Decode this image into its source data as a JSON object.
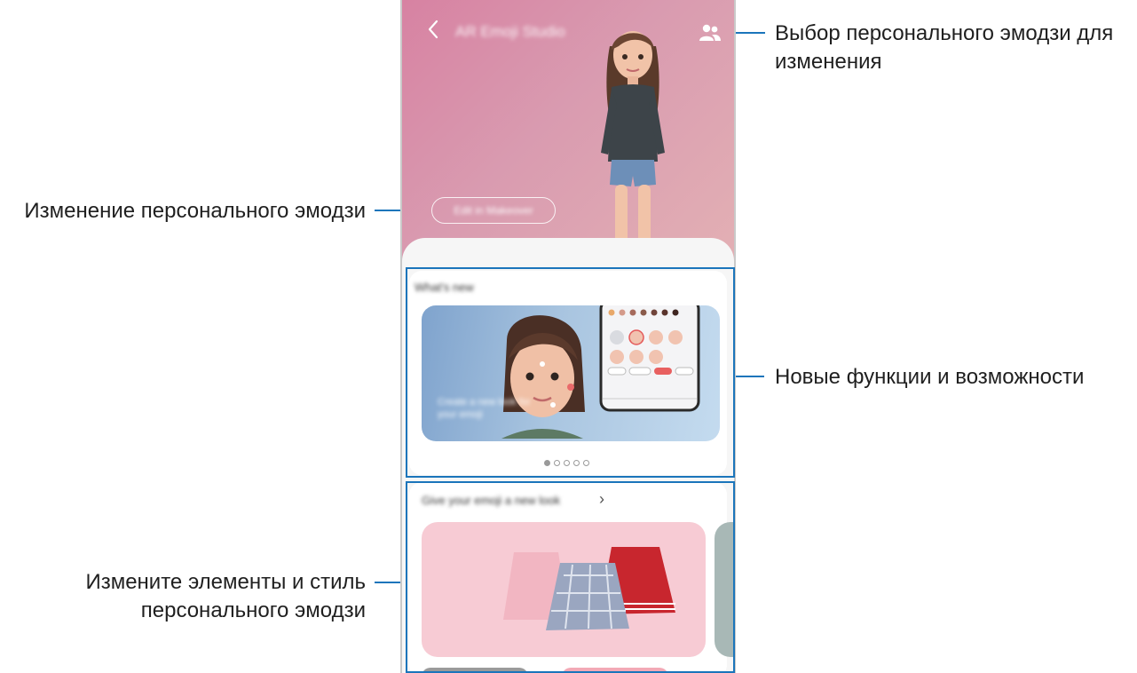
{
  "callouts": {
    "select_emoji": "Выбор персонального эмодзи для изменения",
    "edit_emoji": "Изменение персонального эмодзи",
    "new_features": "Новые функции и возможности",
    "change_items_line1": "Измените элементы и стиль",
    "change_items_line2": "персонального эмодзи"
  },
  "app": {
    "title": "AR Emoji Studio",
    "back_icon": "chevron-left-icon",
    "people_icon": "people-icon",
    "edit_button": "Edit in Makeover",
    "whats_new_title": "What's new",
    "banner_text": "Create a new look for your emoji",
    "dress_title": "Give your emoji a new look",
    "carousel_pages": 5,
    "carousel_active": 1
  },
  "colors": {
    "accent": "#1b75bb",
    "hero_pink": "#d782a2",
    "skirt_card": "#f7cbd4"
  }
}
